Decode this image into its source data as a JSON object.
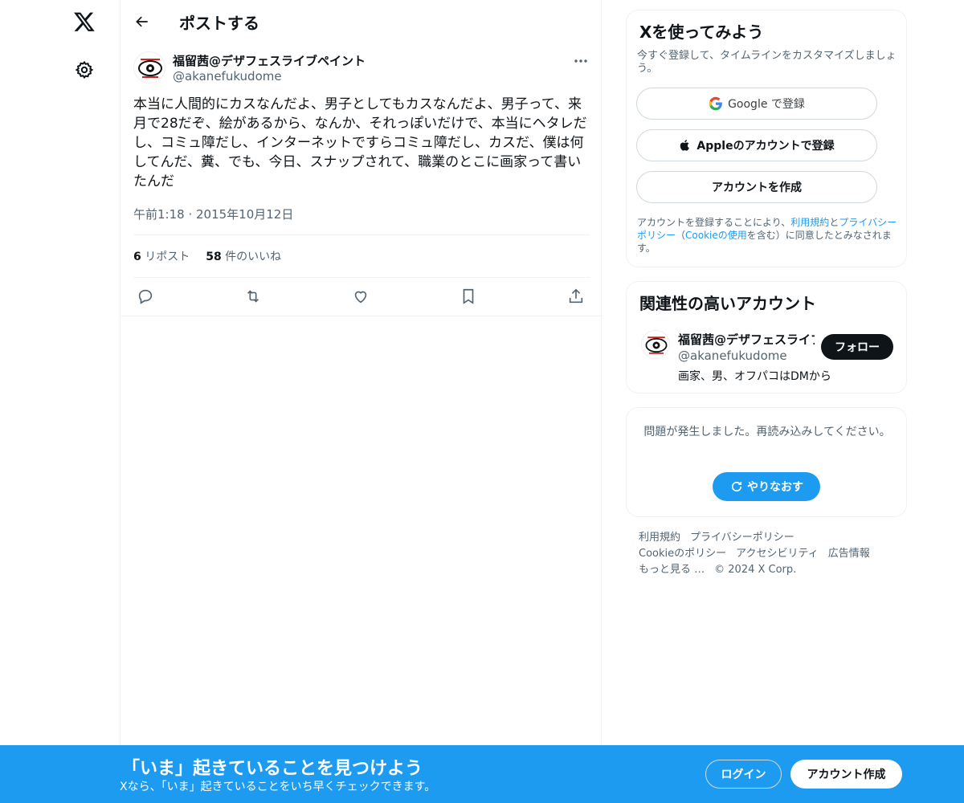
{
  "header": {
    "title": "ポストする"
  },
  "tweet": {
    "author_name": "福留茜@デザフェスライブペイント",
    "author_handle": "@akanefukudome",
    "text": "本当に人間的にカスなんだよ、男子としてもカスなんだよ、男子って、来月で28だぞ、絵があるから、なんか、それっぽいだけで、本当にヘタレだし、コミュ障だし、インターネットですらコミュ障だし、カスだ、僕は何してんだ、糞、でも、今日、スナップされて、職業のとこに画家って書いたんだ",
    "time": "午前1:18 · 2015年10月12日",
    "reposts_count": "6",
    "reposts_label": "リポスト",
    "likes_count": "58",
    "likes_label": "件のいいね"
  },
  "signup": {
    "title": "Xを使ってみよう",
    "subtitle": "今すぐ登録して、タイムラインをカスタマイズしましょう。",
    "google_label": "Google で登録",
    "apple_label": "Appleのアカウントで登録",
    "create_label": "アカウントを作成",
    "terms_pre": "アカウントを登録することにより、",
    "terms_link": "利用規約",
    "terms_and": "と",
    "privacy_link": "プライバシーポリシー",
    "terms_paren_open": "（",
    "cookie_link": "Cookieの使用",
    "terms_post": "を含む）に同意したとみなされます。"
  },
  "related": {
    "title": "関連性の高いアカウント",
    "name": "福留茜@デザフェスライブペイント",
    "handle": "@akanefukudome",
    "bio": "画家、男、オフパコはDMから",
    "follow_label": "フォロー"
  },
  "error": {
    "message": "問題が発生しました。再読み込みしてください。",
    "retry_label": "やりなおす"
  },
  "footer": {
    "terms": "利用規約",
    "privacy": "プライバシーポリシー",
    "cookie": "Cookieのポリシー",
    "accessibility": "アクセシビリティ",
    "ads": "広告情報",
    "more": "もっと見る …",
    "copyright": "© 2024 X Corp."
  },
  "banner": {
    "title": "「いま」起きていることを見つけよう",
    "subtitle": "Xなら、「いま」起きていることをいち早くチェックできます。",
    "login_label": "ログイン",
    "create_label": "アカウント作成"
  },
  "colors": {
    "accent": "#1d9bf0",
    "text": "#0f1419",
    "muted": "#536471",
    "border": "#eff3f4"
  }
}
